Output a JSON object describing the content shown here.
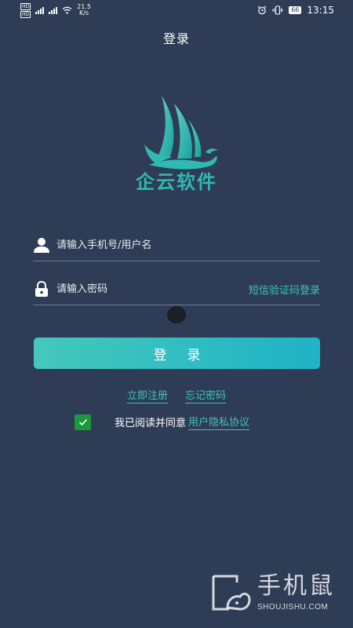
{
  "status_bar": {
    "hd_top": "HD",
    "hd_bottom": "HD",
    "net_speed_value": "21.5",
    "net_speed_unit": "K/s",
    "time": "13:15",
    "battery": "66",
    "icons": [
      "signal-icon",
      "signal-icon",
      "wifi-icon",
      "alarm-icon",
      "vibrate-icon",
      "battery-icon"
    ]
  },
  "header": {
    "title": "登录"
  },
  "logo": {
    "text": "企云软件",
    "icon": "sailboat-logo-icon",
    "color": "#2fb9b3"
  },
  "form": {
    "username_placeholder": "请输入手机号/用户名",
    "password_placeholder": "请输入密码",
    "sms_login_label": "短信验证码登录",
    "login_button_label": "登录"
  },
  "links": {
    "register": "立即注册",
    "forgot_password": "忘记密码"
  },
  "agreement": {
    "checked": true,
    "text": "我已阅读并同意",
    "link": "用户隐私协议"
  },
  "watermark": {
    "title": "手机鼠",
    "subtitle": "SHOUJISHU.COM",
    "icon": "mouse-logo-icon"
  },
  "colors": {
    "background": "#2e3c55",
    "accent": "#3ec3bd",
    "button_start": "#45c8bb",
    "button_end": "#1fb3c6",
    "checkbox": "#1a9a3c"
  }
}
